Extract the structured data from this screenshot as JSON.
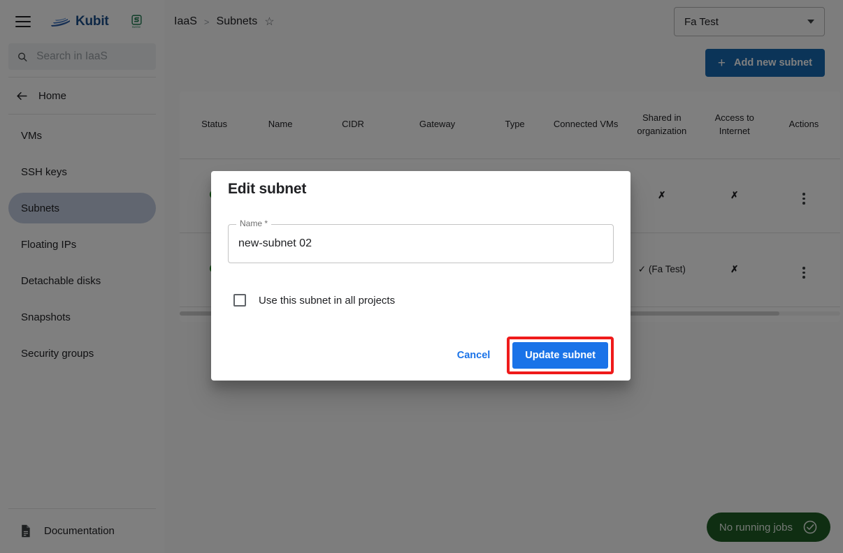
{
  "sidebar": {
    "menu_icon": "hamburger-icon",
    "brand": {
      "name": "Kubit",
      "mark": "boat-icon"
    },
    "partner": {
      "mark": "s-logo-icon",
      "subtext": "Sunrise"
    },
    "search": {
      "value": "",
      "placeholder": "Search in IaaS",
      "icon": "search-icon"
    },
    "home": {
      "label": "Home",
      "icon": "back-arrow-icon"
    },
    "items": [
      {
        "label": "VMs",
        "active": false
      },
      {
        "label": "SSH keys",
        "active": false
      },
      {
        "label": "Subnets",
        "active": true
      },
      {
        "label": "Floating IPs",
        "active": false
      },
      {
        "label": "Detachable disks",
        "active": false
      },
      {
        "label": "Snapshots",
        "active": false
      },
      {
        "label": "Security groups",
        "active": false
      }
    ],
    "footer": {
      "label": "Documentation",
      "icon": "document-icon"
    }
  },
  "header": {
    "breadcrumb": {
      "root": "IaaS",
      "separator": ">",
      "current": "Subnets",
      "star_icon": "star-outline-icon"
    },
    "project_select": {
      "value": "Fa Test",
      "icon": "chevron-down-icon"
    },
    "add_button": {
      "label": "Add new subnet",
      "icon": "plus-icon"
    }
  },
  "table": {
    "columns": [
      "Status",
      "Name",
      "CIDR",
      "Gateway",
      "Type",
      "Connected VMs",
      "Shared in organization",
      "Access to Internet",
      "Actions"
    ],
    "rows": [
      {
        "status": "online",
        "name": "",
        "cidr": "",
        "gateway": "",
        "type": "",
        "connected_vms": "",
        "shared_in_organization": "✗",
        "access_to_internet": "✗",
        "actions_icon": "kebab-menu-icon"
      },
      {
        "status": "online",
        "name": "",
        "cidr": "",
        "gateway": "",
        "type": "",
        "connected_vms": "",
        "shared_in_organization": "✓ (Fa Test)",
        "access_to_internet": "✗",
        "actions_icon": "kebab-menu-icon"
      }
    ]
  },
  "jobs_status": {
    "label": "No running jobs",
    "icon": "check-circle-icon"
  },
  "dialog": {
    "title": "Edit subnet",
    "name_field": {
      "label": "Name *",
      "value": "new-subnet 02",
      "placeholder": ""
    },
    "checkbox": {
      "label": "Use this subnet in all projects",
      "checked": false
    },
    "cancel_label": "Cancel",
    "submit_label": "Update subnet",
    "highlight_color": "#ef1b1b",
    "submit_color": "#1a73e8"
  }
}
